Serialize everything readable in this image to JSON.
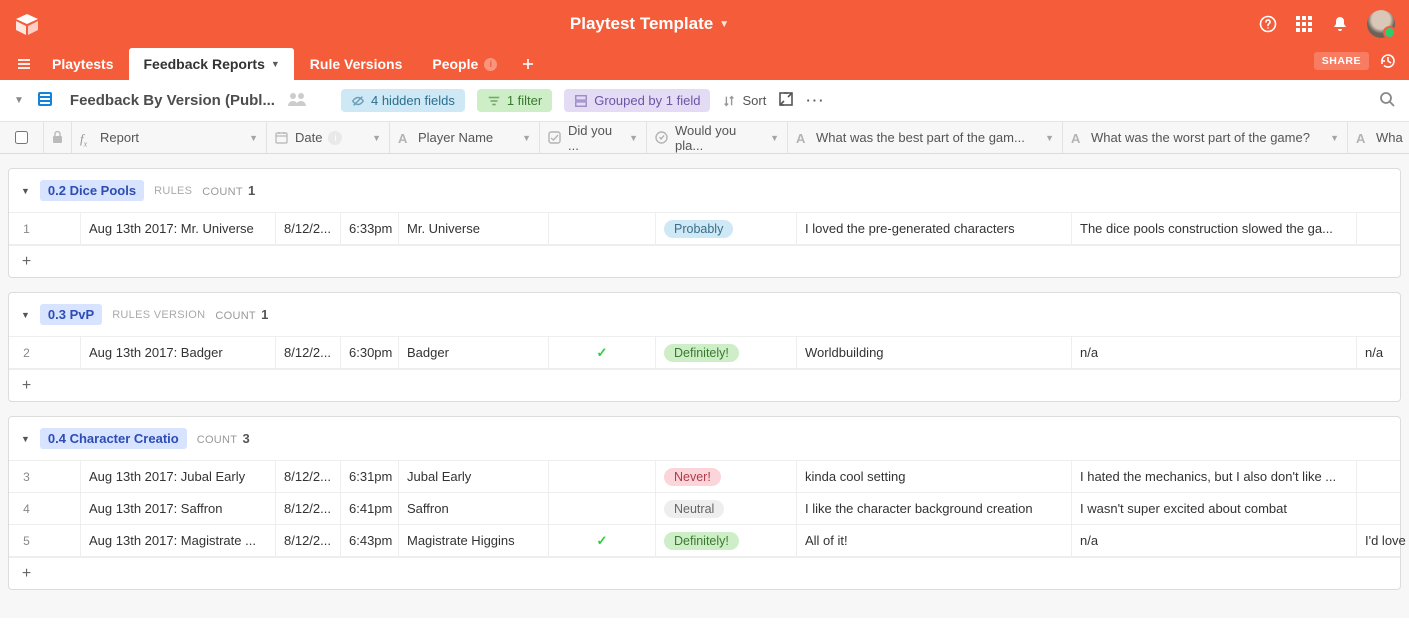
{
  "header": {
    "base_name": "Playtest Template"
  },
  "tabs": {
    "items": [
      {
        "label": "Playtests"
      },
      {
        "label": "Feedback Reports"
      },
      {
        "label": "Rule Versions"
      },
      {
        "label": "People"
      }
    ],
    "share_label": "SHARE"
  },
  "toolbar": {
    "view_name": "Feedback By Version (Publ...",
    "hidden_fields": "4 hidden fields",
    "filter": "1 filter",
    "grouped": "Grouped by 1 field",
    "sort": "Sort"
  },
  "columns": {
    "report": "Report",
    "date": "Date",
    "player": "Player Name",
    "did": "Did you ...",
    "would": "Would you pla...",
    "best": "What was the best part of the gam...",
    "worst": "What was the worst part of the game?",
    "last": "Wha"
  },
  "groups": [
    {
      "title": "0.2 Dice Pools",
      "sub": "RULES",
      "count_label": "COUNT",
      "count": "1",
      "rows": [
        {
          "n": "1",
          "report": "Aug 13th 2017: Mr. Universe",
          "date": "8/12/2...",
          "time": "6:33pm",
          "player": "Mr. Universe",
          "did": "",
          "would": "Probably",
          "would_style": "prob",
          "best": "I loved the pre-generated characters",
          "worst": "The dice pools construction slowed the ga...",
          "last": ""
        }
      ]
    },
    {
      "title": "0.3 PvP",
      "sub": "RULES VERSION",
      "count_label": "COUNT",
      "count": "1",
      "rows": [
        {
          "n": "2",
          "report": "Aug 13th 2017: Badger",
          "date": "8/12/2...",
          "time": "6:30pm",
          "player": "Badger",
          "did": "check",
          "would": "Definitely!",
          "would_style": "def",
          "best": "Worldbuilding",
          "worst": "n/a",
          "last": "n/a"
        }
      ]
    },
    {
      "title": "0.4 Character Creatio",
      "sub": "",
      "count_label": "COUNT",
      "count": "3",
      "rows": [
        {
          "n": "3",
          "report": "Aug 13th 2017: Jubal Early",
          "date": "8/12/2...",
          "time": "6:31pm",
          "player": "Jubal Early",
          "did": "",
          "would": "Never!",
          "would_style": "nev",
          "best": "kinda cool setting",
          "worst": "I hated the mechanics, but I also don't like ...",
          "last": ""
        },
        {
          "n": "4",
          "report": "Aug 13th 2017: Saffron",
          "date": "8/12/2...",
          "time": "6:41pm",
          "player": "Saffron",
          "did": "",
          "would": "Neutral",
          "would_style": "neu",
          "best": "I like the character background creation",
          "worst": "I wasn't super excited about combat",
          "last": ""
        },
        {
          "n": "5",
          "report": "Aug 13th 2017: Magistrate ...",
          "date": "8/12/2...",
          "time": "6:43pm",
          "player": "Magistrate Higgins",
          "did": "check",
          "would": "Definitely!",
          "would_style": "def",
          "best": "All of it!",
          "worst": "n/a",
          "last": "I'd love"
        }
      ]
    }
  ]
}
